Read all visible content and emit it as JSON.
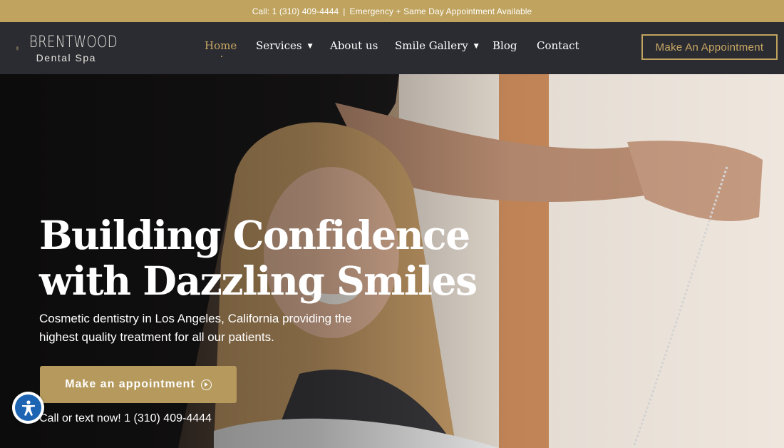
{
  "topbar": {
    "phone_text": "Call: 1 (310) 409-4444",
    "separator": "|",
    "notice": "Emergency + Same Day Appointment Available"
  },
  "brand": {
    "name_line1": "BRENTWOOD",
    "name_line2": "Dental Spa",
    "logo_icon": "tooth-logo-icon"
  },
  "nav": {
    "items": [
      {
        "label": "Home",
        "active": true
      },
      {
        "label": "Services",
        "dropdown": true
      },
      {
        "label": "About us"
      },
      {
        "label": "Smile Gallery",
        "dropdown": true
      },
      {
        "label": "Blog"
      },
      {
        "label": "Contact"
      }
    ],
    "appointment_button": "Make An Appointment",
    "dropdown_icon": "chevron-down-icon"
  },
  "hero": {
    "title_line1": "Building Confidence",
    "title_line2": "with Dazzling Smiles",
    "subtitle_line1": "Cosmetic dentistry in Los Angeles, California providing the",
    "subtitle_line2": "highest quality treatment for all our patients.",
    "cta_label": "Make an appointment",
    "cta_icon": "play-circle-icon",
    "phone_line": "Call or text now! 1 (310) 409-4444"
  },
  "accessibility": {
    "icon": "accessibility-icon"
  },
  "colors": {
    "gold": "#bfa35e",
    "nav_bg": "#2b2c32",
    "accessibility_blue": "#1d64b3"
  }
}
